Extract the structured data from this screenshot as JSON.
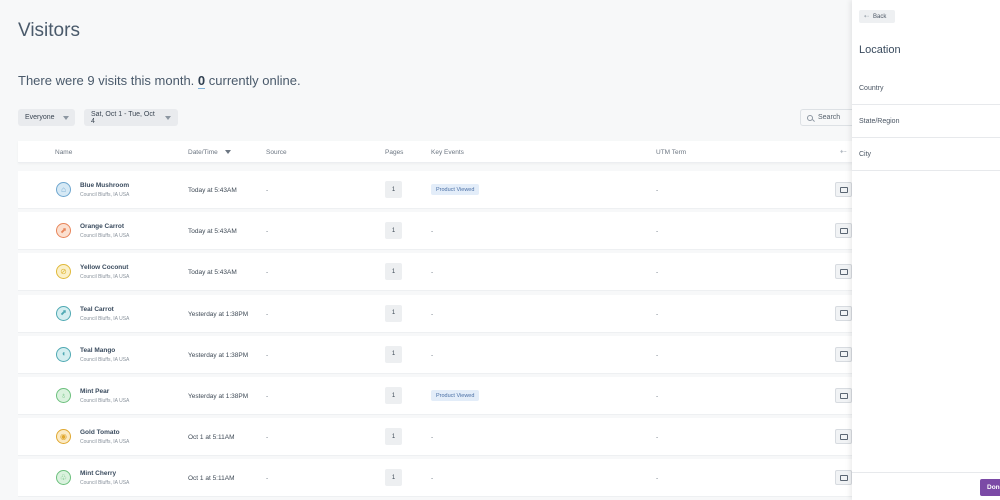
{
  "page": {
    "title": "Visitors",
    "summary_prefix": "There were 9 visits this month.",
    "online_count": "0",
    "summary_suffix": "currently online."
  },
  "filters": {
    "segment": "Everyone",
    "date_range": "Sat, Oct 1 - Tue, Oct 4"
  },
  "search": {
    "placeholder": "Search"
  },
  "table": {
    "columns": [
      "Name",
      "Date/Time",
      "Source",
      "Pages",
      "Key Events",
      "UTM Term"
    ],
    "rows": [
      {
        "name": "Blue Mushroom",
        "location": "Council Bluffs, IA USA",
        "date": "Today at 5:43AM",
        "source": "-",
        "pages": "1",
        "event": "Product Viewed",
        "utm": "-",
        "avatar_color": "#d6e9f5",
        "avatar_ring": "#6ea6cf",
        "icon": "mushroom-icon",
        "glyph": "⌂"
      },
      {
        "name": "Orange Carrot",
        "location": "Council Bluffs, IA USA",
        "date": "Today at 5:43AM",
        "source": "-",
        "pages": "1",
        "event": "-",
        "utm": "-",
        "avatar_color": "#fbe0d0",
        "avatar_ring": "#e8855a",
        "icon": "carrot-icon",
        "glyph": "⬈"
      },
      {
        "name": "Yellow Coconut",
        "location": "Council Bluffs, IA USA",
        "date": "Today at 5:43AM",
        "source": "-",
        "pages": "1",
        "event": "-",
        "utm": "-",
        "avatar_color": "#fbf0c8",
        "avatar_ring": "#e0b93a",
        "icon": "coconut-icon",
        "glyph": "⊘"
      },
      {
        "name": "Teal Carrot",
        "location": "Council Bluffs, IA USA",
        "date": "Yesterday at 1:38PM",
        "source": "-",
        "pages": "1",
        "event": "-",
        "utm": "-",
        "avatar_color": "#d4eef0",
        "avatar_ring": "#4fa9b3",
        "icon": "carrot-icon",
        "glyph": "⬈"
      },
      {
        "name": "Teal Mango",
        "location": "Council Bluffs, IA USA",
        "date": "Yesterday at 1:38PM",
        "source": "-",
        "pages": "1",
        "event": "-",
        "utm": "-",
        "avatar_color": "#d4eef0",
        "avatar_ring": "#4fa9b3",
        "icon": "mango-icon",
        "glyph": "◖"
      },
      {
        "name": "Mint Pear",
        "location": "Council Bluffs, IA USA",
        "date": "Yesterday at 1:38PM",
        "source": "-",
        "pages": "1",
        "event": "Product Viewed",
        "utm": "-",
        "avatar_color": "#daf2de",
        "avatar_ring": "#6cc07d",
        "icon": "pear-icon",
        "glyph": "♁"
      },
      {
        "name": "Gold Tomato",
        "location": "Council Bluffs, IA USA",
        "date": "Oct 1 at 5:11AM",
        "source": "-",
        "pages": "1",
        "event": "-",
        "utm": "-",
        "avatar_color": "#fbeac4",
        "avatar_ring": "#e0a830",
        "icon": "tomato-icon",
        "glyph": "◉"
      },
      {
        "name": "Mint Cherry",
        "location": "Council Bluffs, IA USA",
        "date": "Oct 1 at 5:11AM",
        "source": "-",
        "pages": "1",
        "event": "-",
        "utm": "-",
        "avatar_color": "#daf2de",
        "avatar_ring": "#6cc07d",
        "icon": "cherry-icon",
        "glyph": "♧"
      }
    ]
  },
  "panel": {
    "back_label": "Back",
    "title": "Location",
    "items": [
      "Country",
      "State/Region",
      "City"
    ],
    "done_label": "Done"
  },
  "colors": {
    "accent_purple": "#7b4aa6",
    "badge_bg": "#e3edf9",
    "badge_text": "#4a6fa5"
  }
}
